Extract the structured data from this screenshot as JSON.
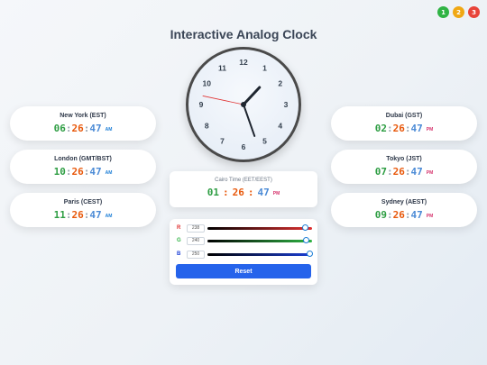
{
  "badges": [
    {
      "label": "1",
      "color": "#2fb344"
    },
    {
      "label": "2",
      "color": "#f0a814"
    },
    {
      "label": "3",
      "color": "#e8443a"
    }
  ],
  "title": "Interactive Analog Clock",
  "clock": {
    "numerals": [
      "12",
      "1",
      "2",
      "3",
      "4",
      "5",
      "6",
      "7",
      "8",
      "9",
      "10",
      "11"
    ],
    "hour": 1,
    "minute": 26,
    "second": 47
  },
  "local": {
    "label": "Cairo Time (EET/EEST)",
    "hh": "01",
    "mm": "26",
    "ss": "47",
    "ampm": "PM"
  },
  "cities_left": [
    {
      "name": "New York (EST)",
      "hh": "06",
      "mm": "26",
      "ss": "47",
      "ampm": "AM"
    },
    {
      "name": "London (GMT/BST)",
      "hh": "10",
      "mm": "26",
      "ss": "47",
      "ampm": "AM"
    },
    {
      "name": "Paris (CEST)",
      "hh": "11",
      "mm": "26",
      "ss": "47",
      "ampm": "AM"
    }
  ],
  "cities_right": [
    {
      "name": "Dubai (GST)",
      "hh": "02",
      "mm": "26",
      "ss": "47",
      "ampm": "PM"
    },
    {
      "name": "Tokyo (JST)",
      "hh": "07",
      "mm": "26",
      "ss": "47",
      "ampm": "PM"
    },
    {
      "name": "Sydney (AEST)",
      "hh": "09",
      "mm": "26",
      "ss": "47",
      "ampm": "PM"
    }
  ],
  "sliders": [
    {
      "label": "R",
      "value": "238",
      "color": "#e03131",
      "level": 0.933
    },
    {
      "label": "G",
      "value": "240",
      "color": "#2fb344",
      "level": 0.941
    },
    {
      "label": "B",
      "value": "250",
      "color": "#1c3fd6",
      "level": 0.98
    }
  ],
  "reset_label": "Reset"
}
